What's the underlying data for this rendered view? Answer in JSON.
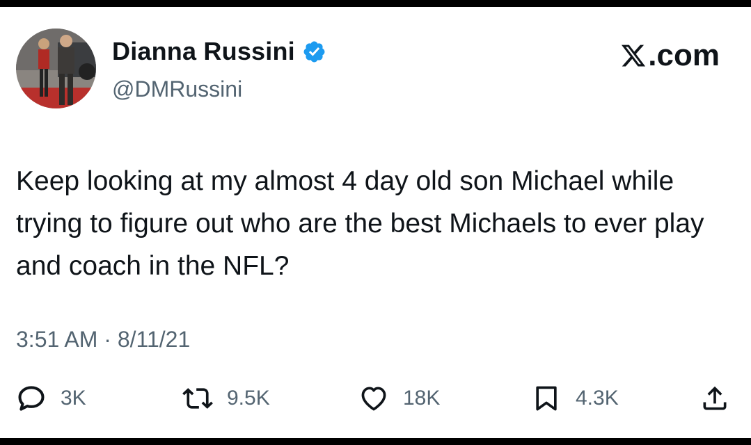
{
  "author": {
    "name": "Dianna Russini",
    "handle": "@DMRussini",
    "verified": true
  },
  "brand": {
    "label": ".com",
    "icon": "x-logo-icon"
  },
  "tweet": {
    "text": "Keep looking at my almost 4 day old son Michael while trying to figure out who are the best Michaels to ever play and coach in the NFL?",
    "timestamp": "3:51 AM · 8/11/21"
  },
  "actions": {
    "replies": "3K",
    "retweets": "9.5K",
    "likes": "18K",
    "bookmarks": "4.3K"
  },
  "colors": {
    "text": "#0f1419",
    "secondary": "#536471",
    "verified": "#1d9bf0"
  }
}
